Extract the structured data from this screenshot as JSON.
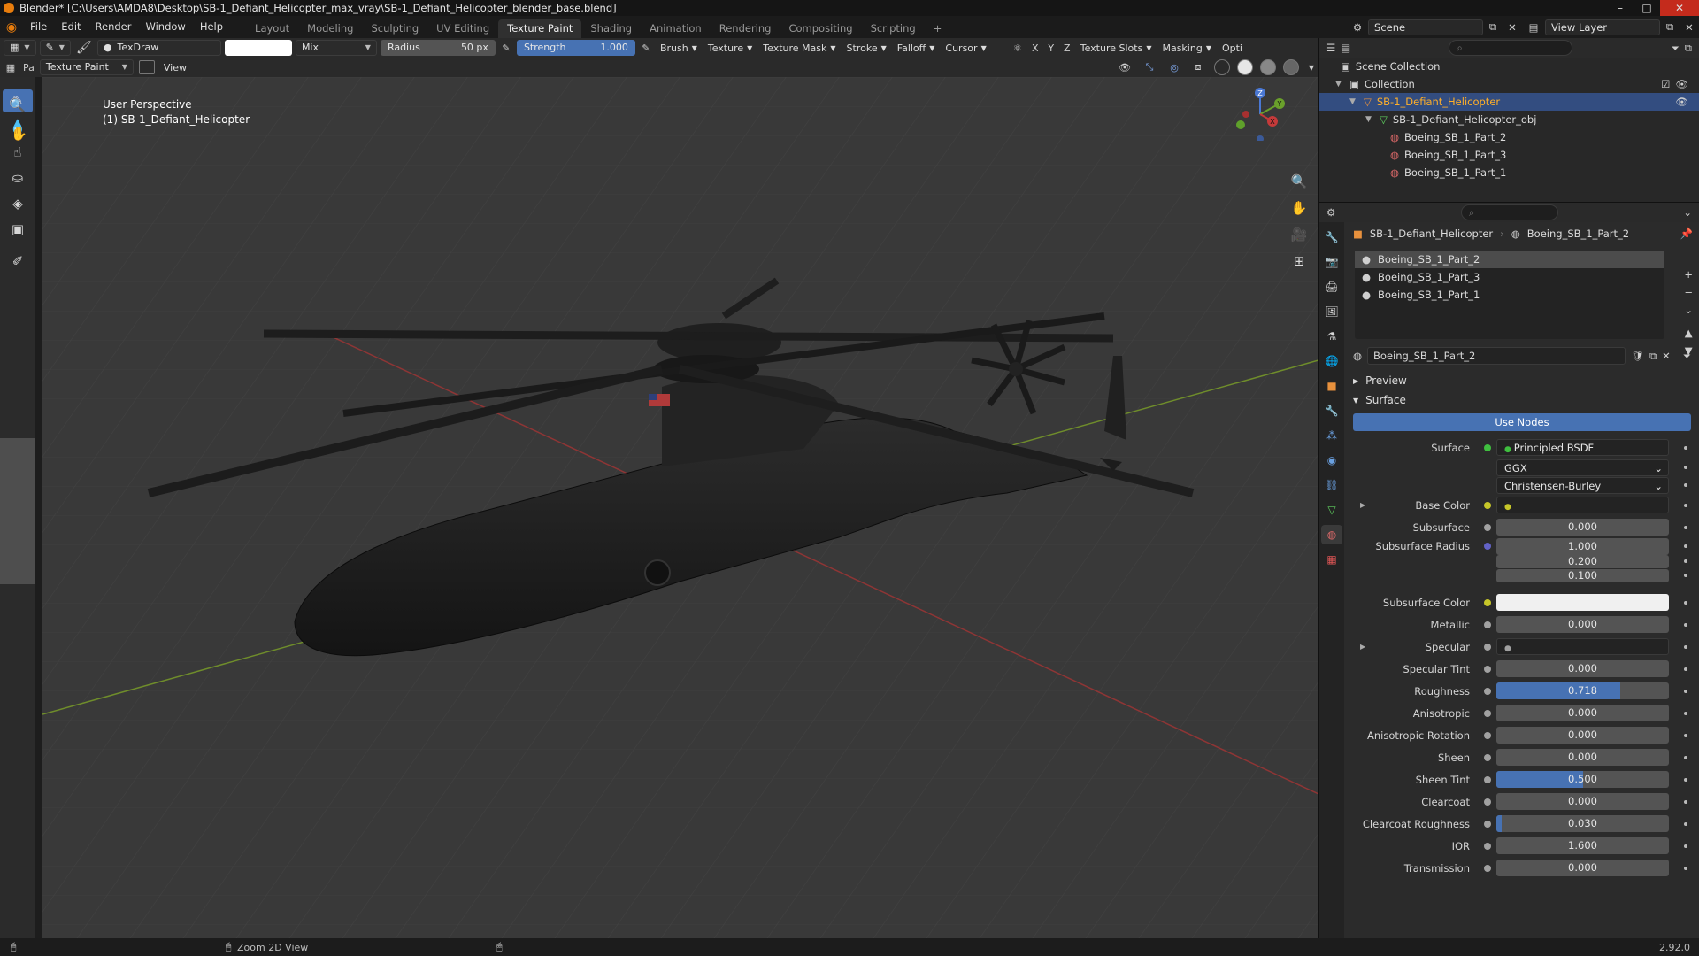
{
  "window": {
    "title": "Blender* [C:\\Users\\AMDA8\\Desktop\\SB-1_Defiant_Helicopter_max_vray\\SB-1_Defiant_Helicopter_blender_base.blend]",
    "controls": [
      "–",
      "□",
      "✕"
    ]
  },
  "menu": [
    "File",
    "Edit",
    "Render",
    "Window",
    "Help"
  ],
  "workspaces": [
    "Layout",
    "Modeling",
    "Sculpting",
    "UV Editing",
    "Texture Paint",
    "Shading",
    "Animation",
    "Rendering",
    "Compositing",
    "Scripting",
    "+"
  ],
  "active_workspace": "Texture Paint",
  "scene": {
    "name": "Scene",
    "view_layer": "View Layer"
  },
  "tool_header": {
    "brush_name": "TexDraw",
    "blend": "Mix",
    "radius_label": "Radius",
    "radius_value": "50 px",
    "strength_label": "Strength",
    "strength_value": "1.000",
    "menus": [
      "Brush",
      "Texture",
      "Texture Mask",
      "Stroke",
      "Falloff",
      "Cursor"
    ],
    "axes": [
      "X",
      "Y",
      "Z"
    ],
    "slots": "Texture Slots",
    "masking": "Masking",
    "opt": "Opti"
  },
  "header2": {
    "mode_short": "Pa",
    "mode": "Texture Paint",
    "view": "View"
  },
  "viewport": {
    "perspective": "User Perspective",
    "object": "(1) SB-1_Defiant_Helicopter",
    "gizmo": {
      "z": "Z",
      "y": "Y",
      "x": "X"
    }
  },
  "outliner": {
    "root": "Scene Collection",
    "items": [
      {
        "label": "Collection",
        "depth": 0
      },
      {
        "label": "SB-1_Defiant_Helicopter",
        "depth": 1
      },
      {
        "label": "SB-1_Defiant_Helicopter_obj",
        "depth": 2
      },
      {
        "label": "Boeing_SB_1_Part_2",
        "depth": 3
      },
      {
        "label": "Boeing_SB_1_Part_3",
        "depth": 3
      },
      {
        "label": "Boeing_SB_1_Part_1",
        "depth": 3
      }
    ]
  },
  "properties": {
    "breadcrumb_object": "SB-1_Defiant_Helicopter",
    "breadcrumb_material": "Boeing_SB_1_Part_2",
    "slots": [
      "Boeing_SB_1_Part_2",
      "Boeing_SB_1_Part_3",
      "Boeing_SB_1_Part_1"
    ],
    "material_name": "Boeing_SB_1_Part_2",
    "preview": "Preview",
    "surface_panel": "Surface",
    "use_nodes": "Use Nodes",
    "rows": [
      {
        "label": "Surface",
        "value": "Principled BSDF",
        "kind": "link",
        "dot": "#3fbf3f"
      },
      {
        "label": "",
        "value": "GGX",
        "kind": "enum"
      },
      {
        "label": "",
        "value": "Christensen-Burley",
        "kind": "enum"
      },
      {
        "label": "Base Color",
        "value": "Boeing_SB_1_Part_2_Diffuse.png",
        "kind": "link",
        "dot": "#c7c729",
        "expand": true
      },
      {
        "label": "Subsurface",
        "value": "0.000",
        "kind": "num",
        "dot": "#a1a1a1"
      },
      {
        "label": "Subsurface Radius",
        "value": "1.000",
        "kind": "num",
        "dot": "#6363c7"
      },
      {
        "label": "",
        "value": "0.200",
        "kind": "num"
      },
      {
        "label": "",
        "value": "0.100",
        "kind": "num"
      },
      {
        "label": "Subsurface Color",
        "value": "",
        "kind": "color",
        "dot": "#c7c729"
      },
      {
        "label": "Metallic",
        "value": "0.000",
        "kind": "num",
        "dot": "#a1a1a1"
      },
      {
        "label": "Specular",
        "value": "Boeing_SB_1_Part_2_Reflection.png",
        "kind": "link",
        "dot": "#a1a1a1",
        "expand": true
      },
      {
        "label": "Specular Tint",
        "value": "0.000",
        "kind": "num",
        "dot": "#a1a1a1"
      },
      {
        "label": "Roughness",
        "value": "0.718",
        "kind": "num",
        "dot": "#a1a1a1",
        "fill": 0.718
      },
      {
        "label": "Anisotropic",
        "value": "0.000",
        "kind": "num",
        "dot": "#a1a1a1"
      },
      {
        "label": "Anisotropic Rotation",
        "value": "0.000",
        "kind": "num",
        "dot": "#a1a1a1"
      },
      {
        "label": "Sheen",
        "value": "0.000",
        "kind": "num",
        "dot": "#a1a1a1"
      },
      {
        "label": "Sheen Tint",
        "value": "0.500",
        "kind": "num",
        "dot": "#a1a1a1",
        "fill": 0.5
      },
      {
        "label": "Clearcoat",
        "value": "0.000",
        "kind": "num",
        "dot": "#a1a1a1"
      },
      {
        "label": "Clearcoat Roughness",
        "value": "0.030",
        "kind": "num",
        "dot": "#a1a1a1",
        "fill": 0.03
      },
      {
        "label": "IOR",
        "value": "1.600",
        "kind": "num",
        "dot": "#a1a1a1"
      },
      {
        "label": "Transmission",
        "value": "0.000",
        "kind": "num",
        "dot": "#a1a1a1"
      }
    ]
  },
  "status": {
    "hint": "Zoom 2D View",
    "version": "2.92.0"
  },
  "colors": {
    "accent": "#4772b3",
    "selection": "#334d80",
    "close": "#c42b1c"
  }
}
